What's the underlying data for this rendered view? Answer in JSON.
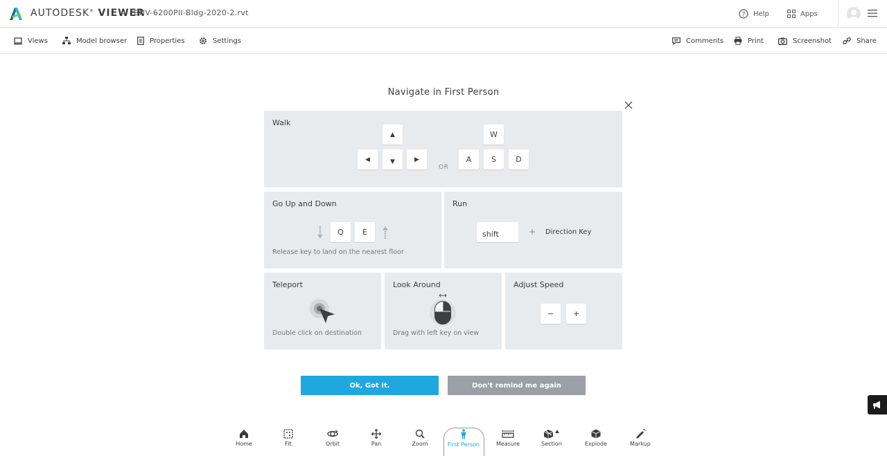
{
  "header": {
    "brand_light": "AUTODESK",
    "brand_bold": "VIEWER",
    "filename": "BNV-6200PII-Bldg-2020-2.rvt",
    "help_label": "Help",
    "apps_label": "Apps"
  },
  "toolbar": {
    "views": "Views",
    "model_browser": "Model browser",
    "properties": "Properties",
    "settings": "Settings",
    "comments": "Comments",
    "print": "Print",
    "screenshot": "Screenshot",
    "share": "Share"
  },
  "dialog": {
    "title": "Navigate in First Person",
    "walk": {
      "title": "Walk",
      "or": "OR",
      "keys": [
        "W",
        "A",
        "S",
        "D"
      ]
    },
    "updown": {
      "title": "Go Up and Down",
      "keys": [
        "Q",
        "E"
      ],
      "caption": "Release key to land on the nearest floor"
    },
    "run": {
      "title": "Run",
      "key": "shift",
      "plus": "+",
      "direction": "Direction Key"
    },
    "teleport": {
      "title": "Teleport",
      "caption": "Double click on destination"
    },
    "look": {
      "title": "Look Around",
      "caption": "Drag with left key on view"
    },
    "speed": {
      "title": "Adjust Speed",
      "minus": "−",
      "plus": "+"
    },
    "ok_label": "Ok, Got It.",
    "dont_remind_label": "Don't remind me again"
  },
  "bottom_toolbar": {
    "items": [
      "Home",
      "Fit",
      "Orbit",
      "Pan",
      "Zoom",
      "First Person",
      "Measure",
      "Section",
      "Explode",
      "Markup"
    ],
    "active": "First Person",
    "active_color": "#1fa7df"
  }
}
